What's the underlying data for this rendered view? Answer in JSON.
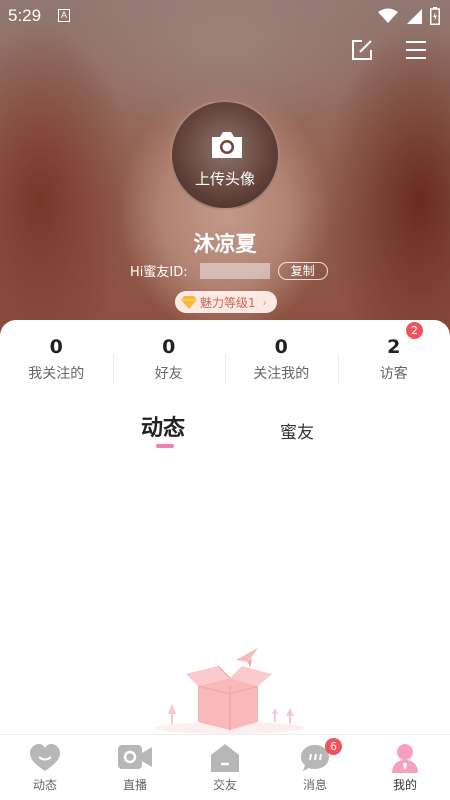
{
  "status_bar": {
    "time": "5:29",
    "notification_letter": "A"
  },
  "profile": {
    "upload_avatar_label": "上传头像",
    "nickname": "沐凉夏",
    "id_label": "Hi蜜友ID:",
    "copy_label": "复制",
    "charm_level": "魅力等级1",
    "charm_chevron": "›"
  },
  "stats": [
    {
      "count": "0",
      "label": "我关注的"
    },
    {
      "count": "0",
      "label": "好友"
    },
    {
      "count": "0",
      "label": "关注我的"
    },
    {
      "count": "2",
      "label": "访客",
      "badge": "2"
    }
  ],
  "tabs": {
    "active": "动态",
    "other": "蜜友"
  },
  "bottom_nav": [
    {
      "label": "动态",
      "icon": "heart-chat-icon"
    },
    {
      "label": "直播",
      "icon": "video-camera-icon"
    },
    {
      "label": "交友",
      "icon": "house-icon"
    },
    {
      "label": "消息",
      "icon": "message-bubble-icon",
      "badge": "6"
    },
    {
      "label": "我的",
      "icon": "person-icon",
      "active": true
    }
  ],
  "colors": {
    "accent_pink": "#f37fb5",
    "badge_red": "#f0545a",
    "charm_bg": "#fde9e3",
    "charm_text": "#c66b52"
  }
}
